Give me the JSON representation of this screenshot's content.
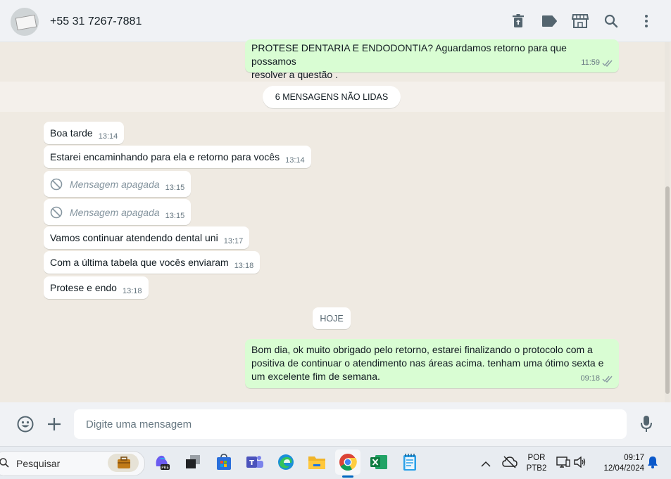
{
  "header": {
    "contact": "+55 31 7267-7881"
  },
  "messages": {
    "top_out": {
      "line1": "PROTESE DENTARIA E ENDODONTIA? Aguardamos retorno para que possamos",
      "line2": "resolver a questão .",
      "time": "11:59"
    },
    "unread_label": "6 MENSAGENS NÃO LIDAS",
    "incoming": [
      {
        "text": "Boa tarde",
        "time": "13:14"
      },
      {
        "text": "Estarei encaminhando para ela e retorno para vocês",
        "time": "13:14"
      },
      {
        "text": "Mensagem apagada",
        "time": "13:15"
      },
      {
        "text": "Mensagem apagada",
        "time": "13:15"
      },
      {
        "text": "Vamos continuar atendendo dental uni",
        "time": "13:17"
      },
      {
        "text": "Com a última tabela que vocês enviaram",
        "time": "13:18"
      },
      {
        "text": "Protese e endo",
        "time": "13:18"
      }
    ],
    "day_label": "HOJE",
    "last_out": {
      "line1": "Bom dia, ok muito obrigado pelo retorno, estarei finalizando o protocolo com a",
      "line2": "positiva de continuar o atendimento nas áreas acima. tenham uma ótimo sexta e",
      "line3": "um excelente fim de semana.",
      "time": "09:18"
    }
  },
  "composer": {
    "placeholder": "Digite uma mensagem"
  },
  "taskbar": {
    "search_label": "Pesquisar",
    "lang1": "POR",
    "lang2": "PTB2",
    "time": "09:17",
    "date": "12/04/2024"
  },
  "colors": {
    "outgoing_bubble": "#d9fdd3",
    "tick": "#8696a0",
    "chat_bg": "#efeae2"
  }
}
